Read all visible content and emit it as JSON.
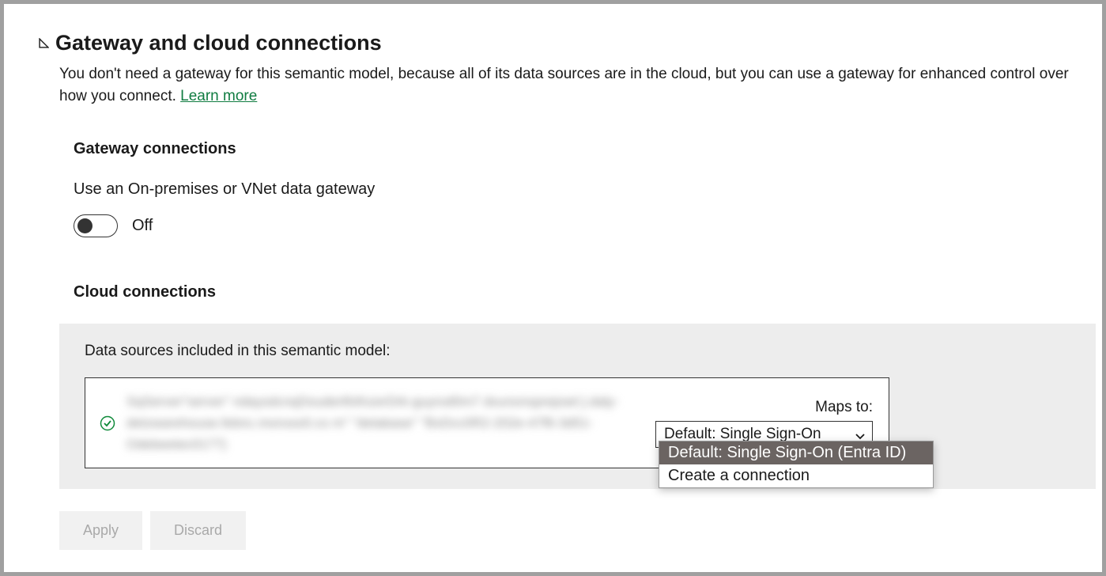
{
  "header": {
    "title": "Gateway and cloud connections",
    "description_prefix": "You don't need a gateway for this semantic model, because all of its data sources are in the cloud, but you can use a gateway for enhanced control over how you connect. ",
    "learn_more": "Learn more"
  },
  "gateway_section": {
    "heading": "Gateway connections",
    "toggle_label": "Use an On-premises or VNet data gateway",
    "toggle_state": "Off"
  },
  "cloud_section": {
    "heading": "Cloud connections",
    "panel_label": "Data sources included in this semantic model:",
    "maps_to_label": "Maps to:",
    "dropdown_selected": "Default: Single Sign-On",
    "dropdown_options": [
      "Default: Single Sign-On (Entra ID)",
      "Create a connection"
    ]
  },
  "actions": {
    "apply": "Apply",
    "discard": "Discard"
  }
}
